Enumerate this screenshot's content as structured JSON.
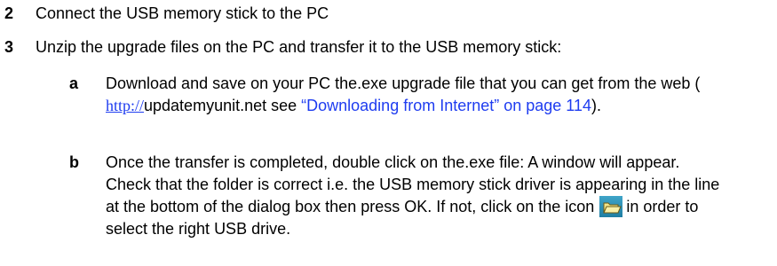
{
  "steps": [
    {
      "number": "2",
      "text": "Connect the USB memory stick to the PC"
    },
    {
      "number": "3",
      "text": "Unzip the upgrade files on the PC and transfer it to the USB memory stick:"
    }
  ],
  "substeps": {
    "a": {
      "letter": "a",
      "text_before": "Download and save on your PC the.exe upgrade file that you can get from the web ( ",
      "http_text": "http://",
      "text_mid": "updatemyunit.net see ",
      "link_text": "“Downloading from Internet” on page 114",
      "text_after": ")."
    },
    "b": {
      "letter": "b",
      "text_before": "Once the transfer is completed, double click on the.exe file: A window will appear. Check that the folder is correct i.e. the USB memory stick driver is appearing in the line at the bottom of the dialog box then press OK. If not, click on the icon",
      "text_after": "in order to select the right USB drive.",
      "icon": "folder-icon"
    }
  },
  "colors": {
    "link": "#1e3cf0",
    "text": "#000000"
  }
}
